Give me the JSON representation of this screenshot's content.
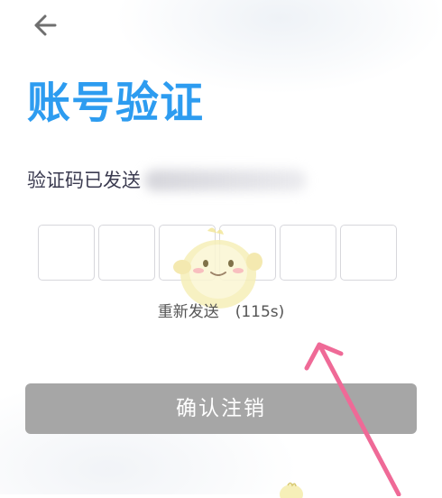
{
  "header": {
    "back_icon": "arrow-left-icon",
    "title": "账号验证"
  },
  "verification": {
    "sent_text": "验证码已发送",
    "code_length": 6,
    "resend_label": "重新发送",
    "countdown": "(115s)"
  },
  "actions": {
    "confirm_label": "确认注销",
    "confirm_disabled": true
  },
  "colors": {
    "title": "#2d9cf0",
    "button_disabled": "#a6a6a6",
    "annotation_arrow": "#ef6a97"
  }
}
